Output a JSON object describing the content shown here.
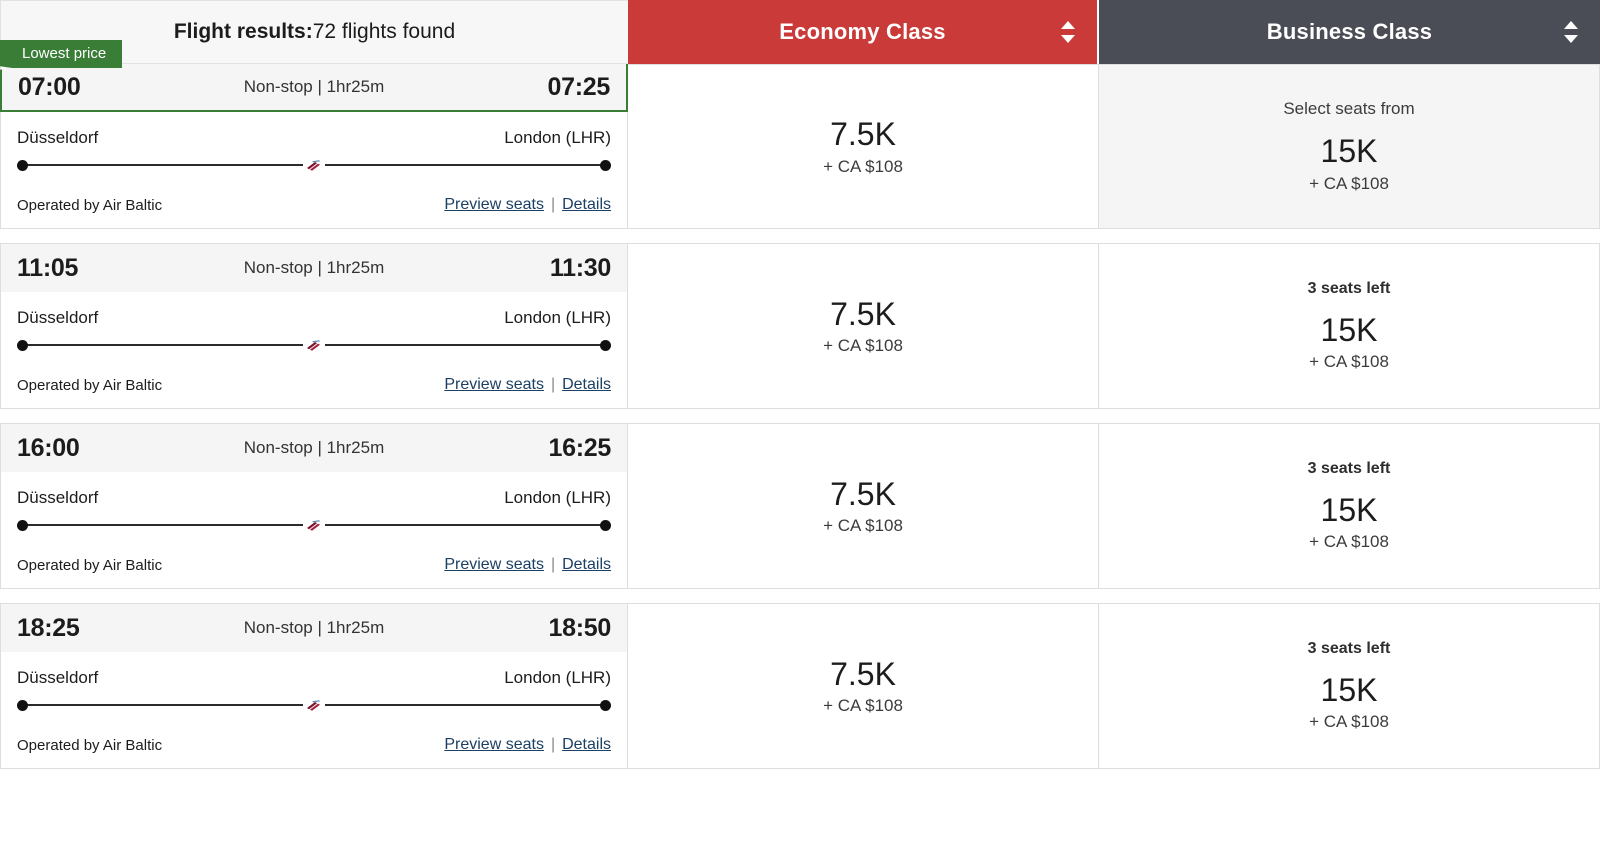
{
  "header": {
    "results_label": "Flight results:",
    "results_count": "72 flights found",
    "tabs": [
      {
        "label": "Economy Class",
        "color": "#c93a38",
        "sort_icon": "sort-updown-icon"
      },
      {
        "label": "Business Class",
        "color": "#4a4d55",
        "sort_icon": "sort-updown-icon"
      }
    ]
  },
  "badges": {
    "lowest_price": "Lowest price"
  },
  "links": {
    "preview_seats": "Preview seats",
    "separator": "|",
    "details": "Details"
  },
  "flights": [
    {
      "badge": "Lowest price",
      "depart_time": "07:00",
      "arrive_time": "07:25",
      "stops_duration": "Non-stop | 1hr25m",
      "origin": "Düsseldorf",
      "destination": "London (LHR)",
      "operator": "Operated by Air Baltic",
      "economy": {
        "note": "",
        "points": "7.5K",
        "cash": "+ CA $108",
        "highlight": false
      },
      "business": {
        "note": "Select seats from",
        "points": "15K",
        "cash": "+ CA $108",
        "highlight": true
      }
    },
    {
      "badge": "",
      "depart_time": "11:05",
      "arrive_time": "11:30",
      "stops_duration": "Non-stop | 1hr25m",
      "origin": "Düsseldorf",
      "destination": "London (LHR)",
      "operator": "Operated by Air Baltic",
      "economy": {
        "note": "",
        "points": "7.5K",
        "cash": "+ CA $108",
        "highlight": false
      },
      "business": {
        "note": "3 seats left",
        "points": "15K",
        "cash": "+ CA $108",
        "highlight": false
      }
    },
    {
      "badge": "",
      "depart_time": "16:00",
      "arrive_time": "16:25",
      "stops_duration": "Non-stop | 1hr25m",
      "origin": "Düsseldorf",
      "destination": "London (LHR)",
      "operator": "Operated by Air Baltic",
      "economy": {
        "note": "",
        "points": "7.5K",
        "cash": "+ CA $108",
        "highlight": false
      },
      "business": {
        "note": "3 seats left",
        "points": "15K",
        "cash": "+ CA $108",
        "highlight": false
      }
    },
    {
      "badge": "",
      "depart_time": "18:25",
      "arrive_time": "18:50",
      "stops_duration": "Non-stop | 1hr25m",
      "origin": "Düsseldorf",
      "destination": "London (LHR)",
      "operator": "Operated by Air Baltic",
      "economy": {
        "note": "",
        "points": "7.5K",
        "cash": "+ CA $108",
        "highlight": false
      },
      "business": {
        "note": "3 seats left",
        "points": "15K",
        "cash": "+ CA $108",
        "highlight": false
      }
    }
  ]
}
